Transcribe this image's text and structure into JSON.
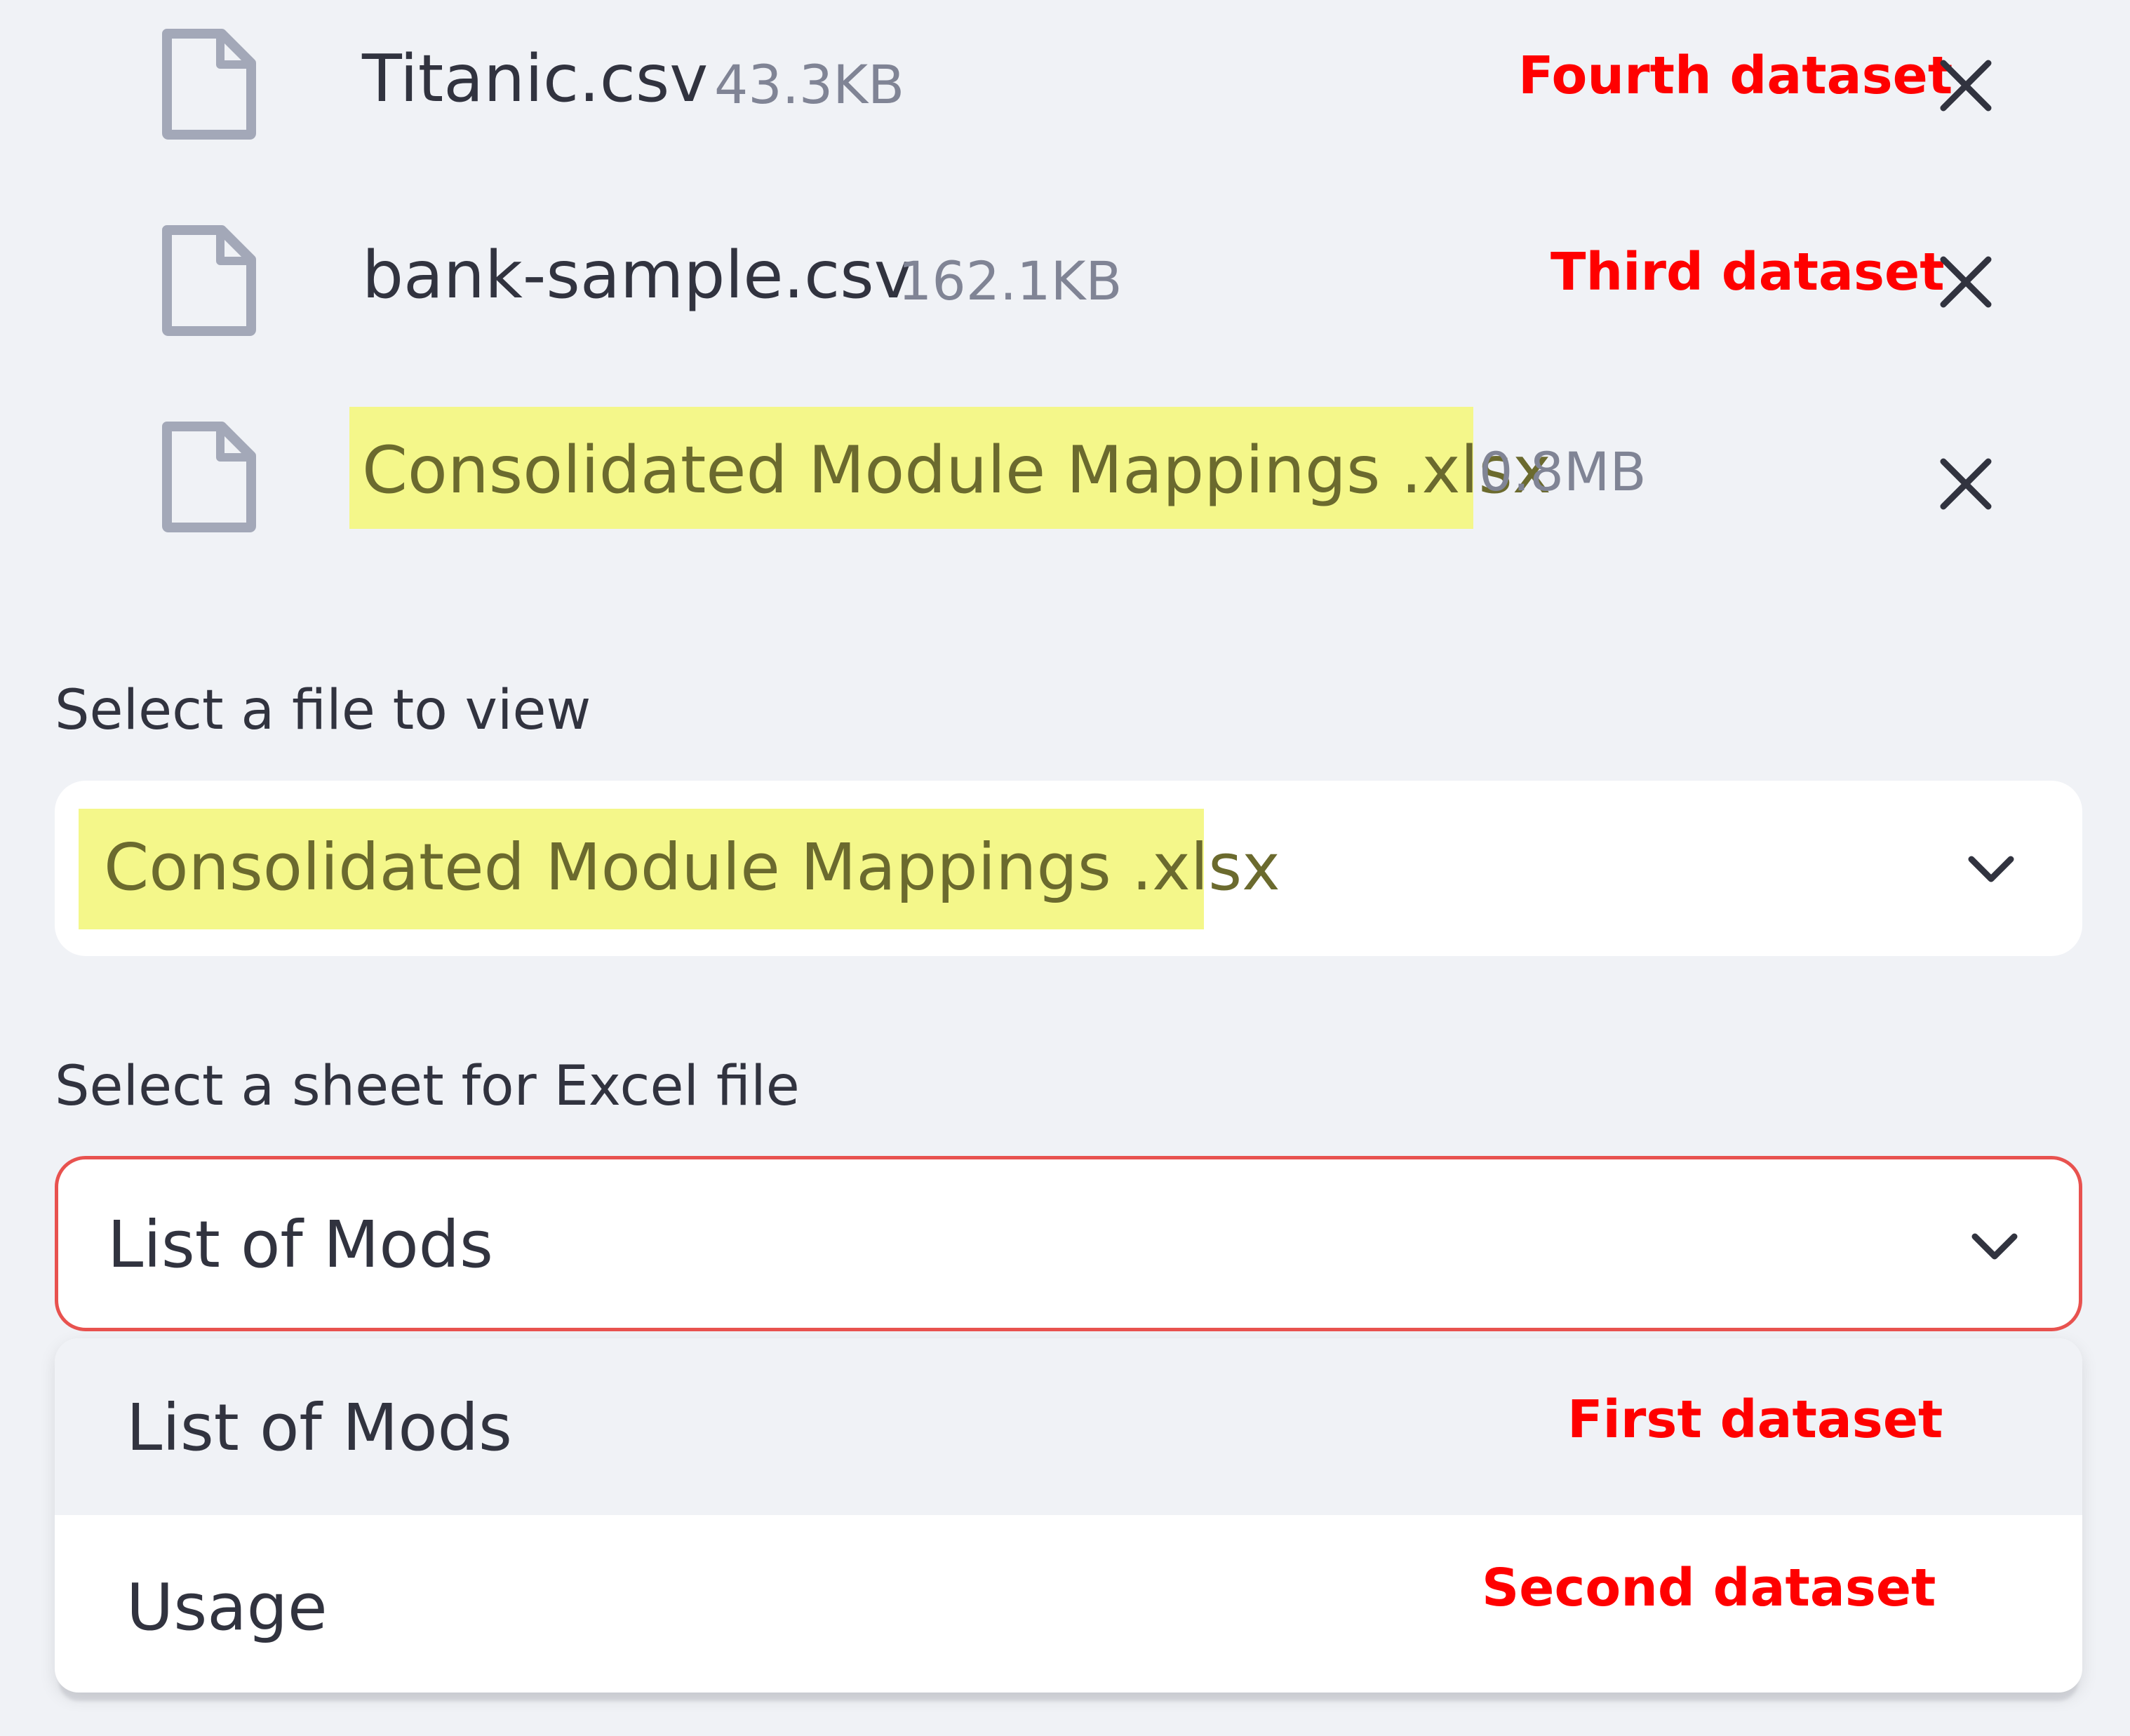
{
  "uploaded_files": [
    {
      "name": "Titanic.csv",
      "size": "43.3KB",
      "annotation": "Fourth dataset",
      "highlighted": false
    },
    {
      "name": "bank-sample.csv",
      "size": "162.1KB",
      "annotation": "Third dataset",
      "highlighted": false
    },
    {
      "name": "Consolidated Module Mappings .xlsx",
      "size": "0.8MB",
      "annotation": "",
      "highlighted": true
    }
  ],
  "file_select": {
    "label": "Select a file to view",
    "value": "Consolidated Module Mappings .xlsx"
  },
  "sheet_select": {
    "label": "Select a sheet for Excel file",
    "value": "List of Mods",
    "options": [
      {
        "label": "List of Mods",
        "annotation": "First dataset"
      },
      {
        "label": "Usage",
        "annotation": "Second dataset"
      }
    ]
  },
  "icons": {
    "file": "file-icon",
    "remove": "close-icon",
    "dropdown": "chevron-down-icon"
  },
  "colors": {
    "background": "#f0f2f6",
    "highlight": "#f4f78a",
    "annotation": "#ff0000",
    "focus_border": "#e8524f",
    "icon": "#a3a8b8",
    "size_text": "#808495"
  }
}
